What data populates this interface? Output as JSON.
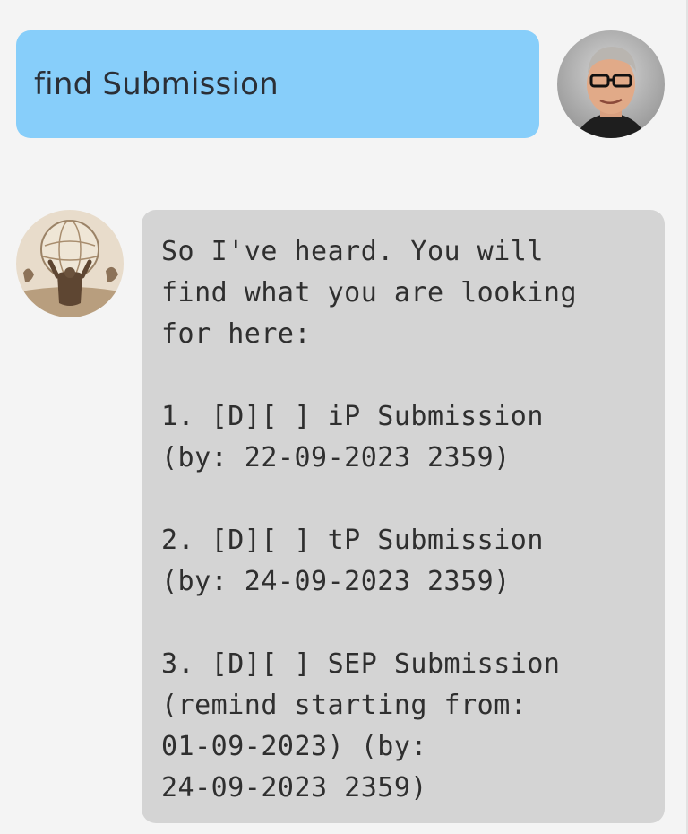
{
  "user_message": {
    "text": "find Submission"
  },
  "bot_message": {
    "text": "So I've heard. You will\nfind what you are looking\nfor here:\n\n1. [D][ ] iP Submission\n(by: 22-09-2023 2359)\n\n2. [D][ ] tP Submission\n(by: 24-09-2023 2359)\n\n3. [D][ ] SEP Submission\n(remind starting from:\n01-09-2023) (by:\n24-09-2023 2359)"
  },
  "avatars": {
    "user": "user-portrait-icon",
    "bot": "atlas-globe-icon"
  },
  "colors": {
    "background": "#f4f4f4",
    "user_bubble": "#87cefa",
    "bot_bubble": "#d4d4d4"
  }
}
